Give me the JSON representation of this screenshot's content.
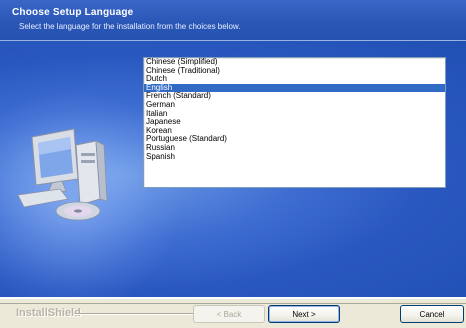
{
  "header": {
    "title": "Choose Setup Language",
    "subtitle": "Select the language for the installation from the choices below."
  },
  "languages": {
    "items": [
      "Chinese (Simplified)",
      "Chinese (Traditional)",
      "Dutch",
      "English",
      "French (Standard)",
      "German",
      "Italian",
      "Japanese",
      "Korean",
      "Portuguese (Standard)",
      "Russian",
      "Spanish"
    ],
    "selected": "English"
  },
  "footer": {
    "brand": "InstallShield",
    "back_label": "< Back",
    "next_label": "Next >",
    "cancel_label": "Cancel"
  },
  "colors": {
    "header": "#2b57b7",
    "panel": "#2958c0",
    "selection": "#316ac5",
    "footer": "#ece9d8"
  },
  "icons": {
    "artwork": "computer-with-cd-icon"
  }
}
